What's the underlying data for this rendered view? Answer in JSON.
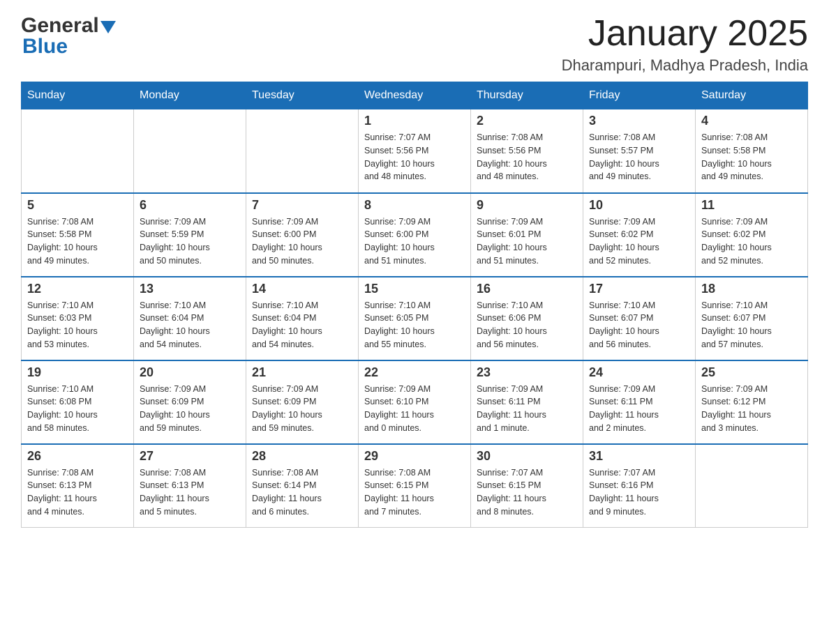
{
  "header": {
    "logo_general": "General",
    "logo_blue": "Blue",
    "title": "January 2025",
    "subtitle": "Dharampuri, Madhya Pradesh, India"
  },
  "days_of_week": [
    "Sunday",
    "Monday",
    "Tuesday",
    "Wednesday",
    "Thursday",
    "Friday",
    "Saturday"
  ],
  "weeks": [
    [
      {
        "day": "",
        "info": ""
      },
      {
        "day": "",
        "info": ""
      },
      {
        "day": "",
        "info": ""
      },
      {
        "day": "1",
        "info": "Sunrise: 7:07 AM\nSunset: 5:56 PM\nDaylight: 10 hours\nand 48 minutes."
      },
      {
        "day": "2",
        "info": "Sunrise: 7:08 AM\nSunset: 5:56 PM\nDaylight: 10 hours\nand 48 minutes."
      },
      {
        "day": "3",
        "info": "Sunrise: 7:08 AM\nSunset: 5:57 PM\nDaylight: 10 hours\nand 49 minutes."
      },
      {
        "day": "4",
        "info": "Sunrise: 7:08 AM\nSunset: 5:58 PM\nDaylight: 10 hours\nand 49 minutes."
      }
    ],
    [
      {
        "day": "5",
        "info": "Sunrise: 7:08 AM\nSunset: 5:58 PM\nDaylight: 10 hours\nand 49 minutes."
      },
      {
        "day": "6",
        "info": "Sunrise: 7:09 AM\nSunset: 5:59 PM\nDaylight: 10 hours\nand 50 minutes."
      },
      {
        "day": "7",
        "info": "Sunrise: 7:09 AM\nSunset: 6:00 PM\nDaylight: 10 hours\nand 50 minutes."
      },
      {
        "day": "8",
        "info": "Sunrise: 7:09 AM\nSunset: 6:00 PM\nDaylight: 10 hours\nand 51 minutes."
      },
      {
        "day": "9",
        "info": "Sunrise: 7:09 AM\nSunset: 6:01 PM\nDaylight: 10 hours\nand 51 minutes."
      },
      {
        "day": "10",
        "info": "Sunrise: 7:09 AM\nSunset: 6:02 PM\nDaylight: 10 hours\nand 52 minutes."
      },
      {
        "day": "11",
        "info": "Sunrise: 7:09 AM\nSunset: 6:02 PM\nDaylight: 10 hours\nand 52 minutes."
      }
    ],
    [
      {
        "day": "12",
        "info": "Sunrise: 7:10 AM\nSunset: 6:03 PM\nDaylight: 10 hours\nand 53 minutes."
      },
      {
        "day": "13",
        "info": "Sunrise: 7:10 AM\nSunset: 6:04 PM\nDaylight: 10 hours\nand 54 minutes."
      },
      {
        "day": "14",
        "info": "Sunrise: 7:10 AM\nSunset: 6:04 PM\nDaylight: 10 hours\nand 54 minutes."
      },
      {
        "day": "15",
        "info": "Sunrise: 7:10 AM\nSunset: 6:05 PM\nDaylight: 10 hours\nand 55 minutes."
      },
      {
        "day": "16",
        "info": "Sunrise: 7:10 AM\nSunset: 6:06 PM\nDaylight: 10 hours\nand 56 minutes."
      },
      {
        "day": "17",
        "info": "Sunrise: 7:10 AM\nSunset: 6:07 PM\nDaylight: 10 hours\nand 56 minutes."
      },
      {
        "day": "18",
        "info": "Sunrise: 7:10 AM\nSunset: 6:07 PM\nDaylight: 10 hours\nand 57 minutes."
      }
    ],
    [
      {
        "day": "19",
        "info": "Sunrise: 7:10 AM\nSunset: 6:08 PM\nDaylight: 10 hours\nand 58 minutes."
      },
      {
        "day": "20",
        "info": "Sunrise: 7:09 AM\nSunset: 6:09 PM\nDaylight: 10 hours\nand 59 minutes."
      },
      {
        "day": "21",
        "info": "Sunrise: 7:09 AM\nSunset: 6:09 PM\nDaylight: 10 hours\nand 59 minutes."
      },
      {
        "day": "22",
        "info": "Sunrise: 7:09 AM\nSunset: 6:10 PM\nDaylight: 11 hours\nand 0 minutes."
      },
      {
        "day": "23",
        "info": "Sunrise: 7:09 AM\nSunset: 6:11 PM\nDaylight: 11 hours\nand 1 minute."
      },
      {
        "day": "24",
        "info": "Sunrise: 7:09 AM\nSunset: 6:11 PM\nDaylight: 11 hours\nand 2 minutes."
      },
      {
        "day": "25",
        "info": "Sunrise: 7:09 AM\nSunset: 6:12 PM\nDaylight: 11 hours\nand 3 minutes."
      }
    ],
    [
      {
        "day": "26",
        "info": "Sunrise: 7:08 AM\nSunset: 6:13 PM\nDaylight: 11 hours\nand 4 minutes."
      },
      {
        "day": "27",
        "info": "Sunrise: 7:08 AM\nSunset: 6:13 PM\nDaylight: 11 hours\nand 5 minutes."
      },
      {
        "day": "28",
        "info": "Sunrise: 7:08 AM\nSunset: 6:14 PM\nDaylight: 11 hours\nand 6 minutes."
      },
      {
        "day": "29",
        "info": "Sunrise: 7:08 AM\nSunset: 6:15 PM\nDaylight: 11 hours\nand 7 minutes."
      },
      {
        "day": "30",
        "info": "Sunrise: 7:07 AM\nSunset: 6:15 PM\nDaylight: 11 hours\nand 8 minutes."
      },
      {
        "day": "31",
        "info": "Sunrise: 7:07 AM\nSunset: 6:16 PM\nDaylight: 11 hours\nand 9 minutes."
      },
      {
        "day": "",
        "info": ""
      }
    ]
  ]
}
